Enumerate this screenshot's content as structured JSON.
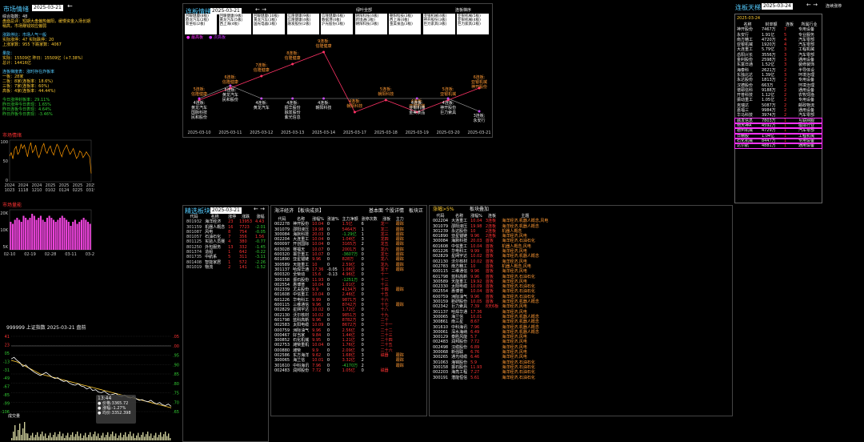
{
  "left": {
    "title": "市场情绪",
    "date": "2025-03-21",
    "back": "←",
    "lines": [
      {
        "t": "综合指数：48",
        "c": "white"
      },
      {
        "t": "盘面总评：短期大盘偏热偏阳，缓慢资金入场长期稍高，市场赚钱效应偏弱",
        "c": "yellow"
      },
      {
        "t": "",
        "c": "white"
      },
      {
        "t": "涨跌停比：市场人气一般",
        "c": "cyan"
      },
      {
        "t": "实际涨停：47  实际跌停：20",
        "c": "yellow"
      },
      {
        "t": "上涨家数：955  下跌家数：4067",
        "c": "yellow"
      },
      {
        "t": "",
        "c": "white"
      },
      {
        "t": "量能：",
        "c": "cyan"
      },
      {
        "t": "实际：15509亿  昨日：15509亿（+7.38%）",
        "c": "yellow"
      },
      {
        "t": "总计：14416亿",
        "c": "yellow"
      },
      {
        "t": "",
        "c": "white"
      },
      {
        "t": "连板梯度表：涨时存在炸板率",
        "c": "cyan"
      },
      {
        "t": "一板：28家",
        "c": "yellow"
      },
      {
        "t": "二板：8家(连板率：18.6%)",
        "c": "yellow"
      },
      {
        "t": "三板：7家(连板率：60%)",
        "c": "yellow"
      },
      {
        "t": "高板：4家(连板率：44.44%)",
        "c": "yellow"
      },
      {
        "t": "",
        "c": "white"
      },
      {
        "t": "今日涨停封板率：29.11%",
        "c": "green"
      },
      {
        "t": "昨日涨停今日表现：1.65%",
        "c": "green"
      },
      {
        "t": "昨日连板今日表现：4.64%",
        "c": "green"
      },
      {
        "t": "昨日炸板今日表现：-3.46%",
        "c": "green"
      }
    ],
    "emotion_label": "市场情绪",
    "emotion_y": [
      "100",
      "50",
      "0"
    ],
    "emotion_x": [
      "2024\n1023",
      "2024\n1118",
      "2024\n1210",
      "2025\n0102",
      "2025\n0124",
      "2025\n0225",
      "2025\n0319"
    ],
    "emotion_series": [
      62,
      70,
      55,
      78,
      85,
      66,
      72,
      90,
      80,
      88,
      75,
      60,
      82,
      94,
      70,
      76,
      88,
      66,
      58,
      70,
      84,
      92,
      74,
      68,
      80,
      86,
      72,
      64,
      78,
      90,
      84,
      70,
      60,
      74,
      82,
      88,
      76,
      66,
      72,
      80,
      68,
      56,
      62,
      74,
      70,
      58,
      64,
      72,
      66,
      60,
      20
    ],
    "vol_label": "市场量能",
    "vol_y": [
      "20K",
      "10K",
      "5K"
    ],
    "vol_x": [
      "02-10",
      "02-19",
      "02-28",
      "03-11",
      "03-20"
    ],
    "vol_series": [
      14,
      13,
      15,
      16,
      15,
      14,
      17,
      16,
      15,
      16,
      18,
      17,
      15,
      16,
      17,
      15,
      14,
      16,
      17,
      16,
      15,
      14,
      15,
      16,
      17,
      16,
      15,
      14,
      12,
      14,
      15,
      13,
      14,
      15,
      16,
      15,
      14,
      13
    ]
  },
  "intraday": {
    "header": "999999  上证指数  2025-03-21  盘前",
    "y_left": [
      "41",
      "23",
      "05",
      "-13",
      "-31",
      "-49",
      "-67",
      "-85",
      "-99",
      "-106"
    ],
    "y_right": [
      ".05",
      ".00",
      ".95",
      ".90",
      ".85",
      ".80",
      ".75",
      ".70",
      ".65"
    ],
    "tooltip_time": "13:44",
    "tooltip_price": "● 价格:3365.72",
    "tooltip_pct": "● 涨幅:-1.27%",
    "tooltip_avg": "● 均价:3352.398",
    "vol_label": "成交量",
    "price_series": [
      70,
      72,
      68,
      65,
      60,
      62,
      58,
      55,
      52,
      50,
      48,
      50,
      52,
      49,
      46,
      44,
      45,
      42,
      40,
      41,
      38,
      36,
      35,
      37,
      34,
      33,
      30,
      32,
      28,
      29,
      26,
      25,
      27,
      24,
      22,
      23,
      24,
      21,
      20,
      22,
      19,
      18,
      20,
      17,
      15,
      16,
      14,
      13,
      15,
      12,
      10,
      12,
      9,
      8,
      10,
      7
    ],
    "avg_series": [
      68,
      67,
      66,
      64,
      62,
      60,
      58,
      56,
      54,
      52,
      50,
      49,
      48,
      47,
      46,
      45,
      44,
      43,
      42,
      41,
      40,
      39,
      38,
      37,
      36,
      35,
      34,
      33,
      32,
      31,
      30,
      29,
      28,
      27,
      26,
      25,
      24,
      23,
      22,
      21,
      20,
      19,
      18,
      17,
      16,
      15,
      14,
      13,
      12,
      11,
      10,
      9,
      8,
      7,
      6,
      5
    ]
  },
  "ladder": {
    "title": "连板情绪",
    "date": "2025-03-21",
    "nav": "←  →",
    "top_label": "绿叶全部",
    "top_right": "连板梯序",
    "legend_a": "最高板",
    "legend_b": "次高板",
    "boxes": [
      [
        "回暖健康(8板)",
        "欧龙汽车(2板)",
        "新坐标(2板)"
      ],
      [
        "回暖健康(9板)",
        "黄龙汽车(5板)",
        "西上海(4板)"
      ],
      [
        "回暖健康(10板)",
        "黄龙汽车(3板)",
        "国光电器(3板)"
      ],
      [
        "信隆健康(9板)",
        "信隆健康(4板)",
        "融发股份(2板)"
      ],
      [
        "信隆健康(6板)",
        "数据港(4板)",
        "沪光股份(3板)"
      ],
      [
        "朝阳科技(4板)",
        "跨境通(3板)",
        "朝阳科技(3板)"
      ],
      [
        "朝阳科技(3板)",
        "西上海(4板)",
        "金美食品(3板)"
      ],
      [
        "亚银机械(4板)",
        "神开股份(3板)",
        "巨力索具(3板)"
      ],
      [
        "亚银机械(5板)",
        "亚银机械(4板)",
        "巨力索具(2板)"
      ]
    ],
    "nodes_top": [
      "5连板:\n信隆健康",
      "6连板:\n信隆健康",
      "7连板:\n信隆健康",
      "8连板:\n信隆健康",
      "9连板:\n信隆健康",
      "4连板:\n朝阳科技",
      "5连板:\n朝阳科技",
      "4连板:\n亚银机械",
      "5连板:\n亚银机械",
      "6连板:\n亚银机械\n神开股份"
    ],
    "nodes_bottom": [
      "4连板:\n黄龙汽车\n国脉科技\n民和股份",
      "5连板:\n黄龙汽车\n民和股份",
      "4连板:\n黄龙汽车",
      "4连板:\n振华股份\n融发股份\n紫光信息",
      "4连板:\n朝阳科技",
      "4连板:\n亚银机械\n金美食品",
      "4连板:\n神开股份\n巨力索具",
      "3连板:\n永安行"
    ],
    "dates": [
      "2025-03-10",
      "2025-03-11",
      "2025-03-12",
      "2025-03-13",
      "2025-03-14",
      "2025-03-17",
      "2025-03-18",
      "2025-03-19",
      "2025-03-20",
      "2025-03-21"
    ],
    "top_series": [
      5,
      6,
      7,
      8,
      9,
      4,
      5,
      4,
      5,
      6
    ],
    "bottom_series": [
      4,
      5,
      4,
      4,
      4,
      4,
      4,
      3
    ]
  },
  "tiantian": {
    "title": "连板天梯",
    "date": "2025-03-24",
    "nav": "←  →",
    "extra": "连续涨停",
    "sub_date": "2025-03-24",
    "headers": [
      "名称",
      "封单额",
      "连板",
      "所属行业"
    ],
    "rows": [
      [
        "神开股份",
        "7467万",
        "7",
        "专用设备"
      ],
      [
        "永安行",
        "1.91亿",
        "5",
        "专业服务"
      ],
      [
        "南方精工",
        "4720万",
        "4",
        "汽车零部"
      ],
      [
        "亚银机械",
        "1920万",
        "4",
        "汽车零部"
      ],
      [
        "大连重工",
        "5.79亿",
        "3",
        "工程机械"
      ],
      [
        "岳阳兴长",
        "3556万",
        "3",
        "汽车零部"
      ],
      [
        "金利股份",
        "2598万",
        "3",
        "通用设备"
      ],
      [
        "东富日通",
        "1.52亿",
        "3",
        "装修装饰"
      ],
      [
        "海泰科",
        "2621万",
        "2",
        "半导体设"
      ],
      [
        "东独北达",
        "1.39亿",
        "3",
        "环境治理"
      ],
      [
        "永达股份",
        "1813万",
        "2",
        "专用设备"
      ],
      [
        "汉德股份",
        "663万",
        "2",
        "环境治理"
      ],
      [
        "谱耶信科",
        "9188万",
        "2",
        "通用设备"
      ],
      [
        "开普科技",
        "1.12亿",
        "2",
        "农牧饲渔"
      ],
      [
        "振动重工",
        "1.05亿",
        "2",
        "专用设备"
      ],
      [
        "克瑞达",
        "5087万",
        "2",
        "邮政物流"
      ],
      [
        "嘉福三",
        "9984万",
        "2",
        "通用设备"
      ],
      [
        "华马科技",
        "3974万",
        "2",
        "汽车零部"
      ],
      [
        "融发信息",
        "7803万",
        "1",
        "互联网服"
      ],
      [
        "南大神A",
        "4592万",
        "1",
        "模拟行业"
      ],
      [
        "德州机械",
        "4729万",
        "1",
        "汽车零部"
      ],
      [
        "日精股",
        "1.04亿",
        "1",
        "工程机械"
      ],
      [
        "石化机械",
        "8447万",
        "1",
        "专用设备"
      ],
      [
        "达尔航",
        "4881万",
        "1",
        "通用设备"
      ]
    ]
  },
  "jingxuan": {
    "title": "精选板块",
    "date": "2025-03-21",
    "nav": "←  →",
    "headers": [
      "代码",
      "名称",
      "涨停",
      "涨跌",
      "涨幅"
    ],
    "rows": [
      [
        "801932",
        "海洋经济",
        "23",
        "13953",
        "4.43"
      ],
      [
        "301159",
        "机器人概念",
        "16",
        "7723",
        "-2.01"
      ],
      [
        "801087",
        "风电",
        "8",
        "754",
        "-0.05"
      ],
      [
        "801057",
        "石油石化",
        "7",
        "356",
        "1.56"
      ],
      [
        "801125",
        "实验人员赛",
        "4",
        "380",
        "-0.77"
      ],
      [
        "801250",
        "外包服务",
        "13",
        "332",
        "-1.45"
      ],
      [
        "801374",
        "造船",
        "1",
        "642",
        "-0.22"
      ],
      [
        "801735",
        "中航系",
        "5",
        "311",
        "-3.11"
      ],
      [
        "801408",
        "智能家居",
        "1",
        "572",
        "-2.26"
      ],
      [
        "801019",
        "物流",
        "2",
        "141",
        "-1.52"
      ]
    ]
  },
  "haiyang": {
    "title": "海洋经济",
    "subtitle": "【板块成员】",
    "tabs": [
      "基本面",
      "个股详情",
      "板块正"
    ],
    "headers": [
      "代码",
      "名称",
      "涨幅%",
      "涨速%",
      "主力净额",
      "涨停次数",
      "涨板",
      "主力"
    ],
    "rows": [
      [
        "002278",
        "神开股份",
        "10.04",
        "0",
        "1.5亿",
        "6",
        "龙一",
        "跟踪"
      ],
      [
        "301079",
        "邵阳液压",
        "19.98",
        "0",
        "5464万",
        "1",
        "龙二",
        "跟踪"
      ],
      [
        "300084",
        "海默科技",
        "20.03",
        "0",
        "-1.29亿",
        "1",
        "龙三",
        "跟踪"
      ],
      [
        "002204",
        "大连重工",
        "10.04",
        "0",
        "1.04亿",
        "3",
        "龙四",
        "跟踪"
      ],
      [
        "600097",
        "开创国际",
        "10.04",
        "0",
        "3165万",
        "2",
        "龙五",
        "跟踪"
      ],
      [
        "603028",
        "赛福天",
        "10.07",
        "0",
        "2001万",
        "0",
        "龙六",
        "跟踪"
      ],
      [
        "600320",
        "振华重工",
        "10.07",
        "0",
        "-3607万",
        "0",
        "龙七",
        "跟踪"
      ],
      [
        "601890",
        "亚星锚链",
        "9.96",
        "0",
        "828万",
        "0",
        "龙八",
        "跟踪"
      ],
      [
        "300589",
        "天能重工",
        "10",
        "0",
        "2.59亿",
        "0",
        "龙九",
        "跟踪"
      ],
      [
        "301137",
        "哈焊华通",
        "17.36",
        "-0.05",
        "1.06亿",
        "0",
        "龙十",
        "跟踪"
      ],
      [
        "600320",
        "全柴动",
        "15.6",
        "-0.13",
        "4.96亿",
        "0",
        "十一",
        ""
      ],
      [
        "300158",
        "振石股份",
        "11.93",
        "0",
        "-1251万",
        "0",
        "十二",
        ""
      ],
      [
        "002554",
        "惠博普",
        "10.04",
        "0",
        "1.01亿",
        "0",
        "十三",
        ""
      ],
      [
        "002339",
        "尤夫股份",
        "9.9",
        "0",
        "4134万",
        "0",
        "十四",
        "跟踪"
      ],
      [
        "601608",
        "中信重工",
        "10.04",
        "0",
        "2.46亿",
        "0",
        "十五",
        ""
      ],
      [
        "601226",
        "华电科工",
        "9.99",
        "0",
        "9871万",
        "0",
        "十六",
        ""
      ],
      [
        "600115",
        "三维通信",
        "9.96",
        "0",
        "8742万",
        "0",
        "十七",
        "跟踪"
      ],
      [
        "002829",
        "星网宇达",
        "10.02",
        "0",
        "1.72亿",
        "0",
        "十八",
        ""
      ],
      [
        "002130",
        "沃尔核材",
        "10.02",
        "0",
        "9851万",
        "0",
        "十九",
        ""
      ],
      [
        "601798",
        "蓝科高新",
        "9.96",
        "0",
        "8782万",
        "0",
        "二十",
        ""
      ],
      [
        "002583",
        "太阳电缆",
        "10.09",
        "0",
        "8672万",
        "0",
        "二十一",
        ""
      ],
      [
        "000759",
        "洲际油气",
        "9.96",
        "0",
        "2.56亿",
        "0",
        "二十二",
        ""
      ],
      [
        "000467",
        "好当家",
        "9.84",
        "0",
        "1.44亿",
        "0",
        "二十三",
        ""
      ],
      [
        "300852",
        "石化机械",
        "9.95",
        "0",
        "1.21亿",
        "0",
        "二十四",
        ""
      ],
      [
        "002753",
        "潍柴重机",
        "10.04",
        "0",
        "1.76亿",
        "0",
        "二十五",
        ""
      ],
      [
        "000880",
        "潍柴",
        "9.9",
        "0",
        "2.09亿",
        "0",
        "二十六",
        ""
      ],
      [
        "002586",
        "东方海洋",
        "9.62",
        "0",
        "1.68亿",
        "3",
        "磁器",
        "跟踪"
      ],
      [
        "300065",
        "海兰信",
        "10.01",
        "0",
        "3.32亿",
        "2",
        "",
        "跟踪"
      ],
      [
        "301610",
        "中科海讯",
        "7.96",
        "0",
        "-4170万",
        "2",
        "",
        "跟踪"
      ],
      [
        "002483",
        "润邦股份",
        "7.72",
        "0",
        "1.05亿",
        "0",
        "磁器",
        ""
      ]
    ]
  },
  "zhangfu": {
    "title": "涨幅>5%",
    "subtitle": "板块叠加",
    "headers": [
      "代码",
      "名称",
      "涨幅%",
      "连板",
      "主题"
    ],
    "rows": [
      [
        "002204",
        "大连重工",
        "10.04",
        "3连板",
        "海洋经济,机器人概念,风电"
      ],
      [
        "301079",
        "邵阳液压",
        "19.98",
        "2连板",
        "海洋经济,机器人概念"
      ],
      [
        "301239",
        "永达股份",
        "10",
        "2连板",
        "机器人概念"
      ],
      [
        "601890",
        "亚星锚链",
        "9.96",
        "2连板",
        "海洋经济,风电"
      ],
      [
        "300084",
        "海默科技",
        "20.03",
        "首板",
        "海洋经济,石油石化"
      ],
      [
        "601608",
        "中信重工",
        "10.04",
        "首板",
        "机器人概念,风电"
      ],
      [
        "601226",
        "华电科工",
        "9.99",
        "首板",
        "海洋经济,风电"
      ],
      [
        "002829",
        "星网宇达",
        "10.02",
        "首板",
        "海洋经济,机器人概念"
      ],
      [
        "002130",
        "沃尔核材",
        "10.02",
        "首板",
        "海洋经济,风电"
      ],
      [
        "002783",
        "南方精工",
        "10",
        "首板",
        "机器人概念,风电"
      ],
      [
        "600115",
        "三维通信",
        "9.96",
        "首板",
        "海洋经济,风电"
      ],
      [
        "601798",
        "蓝科高新",
        "9.96",
        "首板",
        "海洋经济,石油石化"
      ],
      [
        "300589",
        "天能重工",
        "19.92",
        "首板",
        "海洋经济,风电"
      ],
      [
        "002330",
        "太阳电缆",
        "10.09",
        "首板",
        "海洋经济,石油石化"
      ],
      [
        "002554",
        "惠博普",
        "10.04",
        "首板",
        "海洋经济,石油石化"
      ],
      [
        "600759",
        "洲际油气",
        "9.96",
        "首板",
        "海洋经济,石油石化"
      ],
      [
        "300159",
        "新研股份",
        "10.05",
        "首板",
        "海洋经济,机器人概念"
      ],
      [
        "002342",
        "巨力索具",
        "7.39",
        "8天6板",
        "海洋经济,风电"
      ],
      [
        "301137",
        "哈焊华通",
        "17.36",
        "",
        "海洋经济,风电"
      ],
      [
        "300065",
        "海兰信",
        "10.01",
        "",
        "海洋经济,机器人概念"
      ],
      [
        "300861",
        "南三星",
        "8.67",
        "",
        "海洋经济,机器人概念"
      ],
      [
        "301610",
        "中科海讯",
        "7.96",
        "",
        "海洋经济,机器人概念"
      ],
      [
        "300061",
        "深水海纳",
        "6.49",
        "",
        "海洋经济,机器人概念"
      ],
      [
        "300129",
        "泰胜风能",
        "5.7",
        "",
        "海洋经济,风电"
      ],
      [
        "002483",
        "润邦股份",
        "7.72",
        "",
        "海洋经济,风电"
      ],
      [
        "002498",
        "汉缆股份",
        "6.89",
        "",
        "海洋经济,风电"
      ],
      [
        "300068",
        "新强联",
        "6.76",
        "",
        "海洋经济,风电"
      ],
      [
        "300265",
        "通光线缆",
        "6.46",
        "",
        "海洋经济,风电"
      ],
      [
        "301063",
        "海锅股份",
        "5.9",
        "",
        "海洋经济,石油石化"
      ],
      [
        "300158",
        "振石股份",
        "11.93",
        "",
        "海洋经济,石油石化"
      ],
      [
        "002203",
        "海亮工程",
        "7.27",
        "",
        "海洋经济,石油石化"
      ],
      [
        "300191",
        "潜能恒信",
        "5.61",
        "",
        "海洋经济,石油石化"
      ]
    ]
  }
}
